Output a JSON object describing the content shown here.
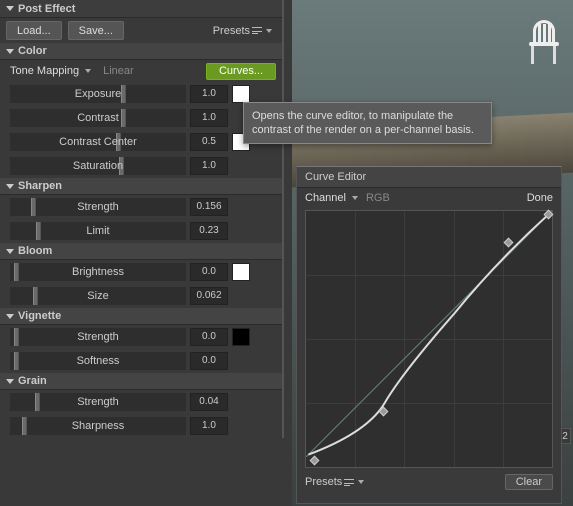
{
  "header": {
    "title": "Post Effect",
    "load": "Load...",
    "save": "Save...",
    "presets": "Presets"
  },
  "color": {
    "title": "Color",
    "tone_mapping_label": "Tone Mapping",
    "tone_mode": "Linear",
    "curves_btn": "Curves...",
    "exposure": {
      "label": "Exposure",
      "value": "1.0",
      "pos": 0.63,
      "swatch": "#ffffff"
    },
    "contrast": {
      "label": "Contrast",
      "value": "1.0",
      "pos": 0.63
    },
    "contrast_center": {
      "label": "Contrast Center",
      "value": "0.5",
      "pos": 0.6,
      "swatch": "#ffffff"
    },
    "saturation": {
      "label": "Saturation",
      "value": "1.0",
      "pos": 0.62
    }
  },
  "sharpen": {
    "title": "Sharpen",
    "strength": {
      "label": "Strength",
      "value": "0.156",
      "pos": 0.12
    },
    "limit": {
      "label": "Limit",
      "value": "0.23",
      "pos": 0.15
    }
  },
  "bloom": {
    "title": "Bloom",
    "brightness": {
      "label": "Brightness",
      "value": "0.0",
      "pos": 0.02,
      "swatch": "#ffffff"
    },
    "size": {
      "label": "Size",
      "value": "0.062",
      "pos": 0.13
    }
  },
  "vignette": {
    "title": "Vignette",
    "strength": {
      "label": "Strength",
      "value": "0.0",
      "pos": 0.02,
      "swatch": "#000000"
    },
    "softness": {
      "label": "Softness",
      "value": "0.0",
      "pos": 0.02
    }
  },
  "grain": {
    "title": "Grain",
    "strength": {
      "label": "Strength",
      "value": "0.04",
      "pos": 0.14
    },
    "sharpness": {
      "label": "Sharpness",
      "value": "1.0",
      "pos": 0.07
    }
  },
  "tooltip": "Opens the curve editor, to manipulate the contrast of the render on a per-channel basis.",
  "curve_editor": {
    "title": "Curve Editor",
    "channel_label": "Channel",
    "channel_value": "RGB",
    "done": "Done",
    "presets": "Presets",
    "clear": "Clear"
  },
  "side_number": "2",
  "chart_data": {
    "type": "line",
    "title": "Curve Editor",
    "xlabel": "",
    "ylabel": "",
    "xlim": [
      0,
      1
    ],
    "ylim": [
      0,
      1
    ],
    "series": [
      {
        "name": "RGB",
        "x": [
          0.0,
          0.1,
          0.2,
          0.3,
          0.4,
          0.5,
          0.6,
          0.7,
          0.8,
          0.9,
          1.0
        ],
        "y": [
          0.0,
          0.06,
          0.13,
          0.22,
          0.33,
          0.46,
          0.6,
          0.73,
          0.85,
          0.94,
          1.0
        ]
      },
      {
        "name": "identity",
        "x": [
          0.0,
          1.0
        ],
        "y": [
          0.0,
          1.0
        ]
      }
    ],
    "control_points": [
      {
        "x": 0.02,
        "y": 0.02
      },
      {
        "x": 0.32,
        "y": 0.22
      },
      {
        "x": 0.82,
        "y": 0.88
      },
      {
        "x": 0.99,
        "y": 0.99
      }
    ],
    "grid": {
      "vlines": 5,
      "hlines": 3
    }
  }
}
